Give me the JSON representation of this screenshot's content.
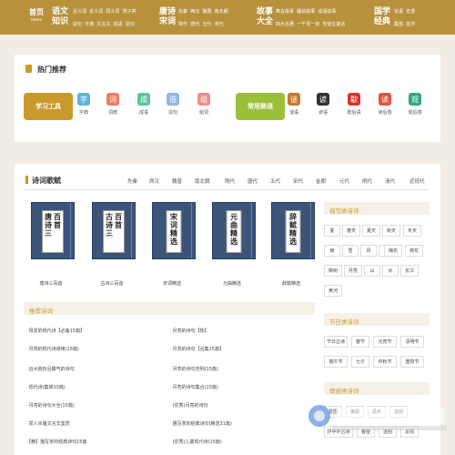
{
  "nav": {
    "home": "首页",
    "home_sub": "Home",
    "lang": "语文",
    "lang2": "知识",
    "lang_links": [
      "近义词",
      "反义词",
      "同义词",
      "类子类",
      "造句",
      "字典",
      "文言文",
      "成语",
      "造句"
    ],
    "poetry": "唐诗",
    "poetry2": "宋词",
    "poetry_links": [
      "先秦",
      "两汉",
      "魏晋",
      "南北朝",
      "隋代",
      "唐代",
      "五代",
      "宋代"
    ],
    "story": "故事",
    "story2": "大全",
    "story_links": [
      "寓言故事",
      "睡前故事",
      "成语故事",
      "四大名著",
      "一千零一夜",
      "安徒生童话"
    ],
    "classic": "国学",
    "classic2": "经典",
    "classic_links": [
      "论语",
      "史部",
      "集部",
      "善学"
    ]
  },
  "hot": {
    "title": "热门推荐",
    "study_label": "学习工具",
    "study_tools": [
      "字典",
      "词典",
      "成语",
      "造句",
      "组词"
    ],
    "common_label": "常用熟语",
    "common_tools": [
      "谜语",
      "谚语",
      "歇后语",
      "读后感",
      "观后感"
    ]
  },
  "poems": {
    "title": "诗词歌赋",
    "tabs": [
      "先秦",
      "两汉",
      "魏晋",
      "南北朝",
      "隋代",
      "唐代",
      "五代",
      "宋代",
      "金朝",
      "元代",
      "明代",
      "清代",
      "近现代"
    ],
    "books": [
      {
        "label": "唐诗三百首",
        "caption": "唐诗三百首"
      },
      {
        "label": "古诗三百首",
        "caption": "古诗三百首"
      },
      {
        "label": "宋词精选",
        "caption": "宋词精选"
      },
      {
        "label": "元曲精选",
        "caption": "元曲精选"
      },
      {
        "label": "辞赋精选",
        "caption": "辞赋精选"
      }
    ]
  },
  "recommend": {
    "title": "推荐诗词",
    "left": [
      "母爱的现代诗【必备15篇】",
      "月亮的现代诗通用(15篇)",
      "远大抱负且霸气的诗句",
      "现代诗(集锦15篇)",
      "月亮的诗句大全(15篇)",
      "郑人买履文言文鉴赏",
      "【精】描写茶的经典诗句15篇"
    ],
    "right": [
      "月亮的诗句【热】",
      "月亮的诗句【合集15篇】",
      "月亮的诗句范例(15篇)",
      "月亮的诗句集合(15篇)",
      "(优秀)月亮的诗句",
      "描写茶的经典诗句(精选31篇)",
      "(优秀)儿童现代诗(15篇)"
    ]
  },
  "scenery": {
    "title": "描写类诗词",
    "cells": [
      [
        "夏",
        "春天",
        "夏天",
        "秋天",
        "冬天"
      ],
      [
        "雨",
        "雪",
        "风",
        "花",
        "梅花",
        "荷花"
      ],
      [
        "柳树",
        "月亮",
        "山",
        "水",
        "长江"
      ],
      [
        "黄河"
      ]
    ]
  },
  "festival": {
    "title": "节日类诗词",
    "cells": [
      [
        "节日古诗",
        "春节",
        "元宵节",
        "清明节"
      ],
      [
        "端午节",
        "七夕",
        "中秋节",
        "重阳节"
      ]
    ]
  },
  "emotion": {
    "title": "情感类诗词",
    "cells": [
      [
        "爱国",
        "离别",
        "思乡",
        "送别"
      ],
      [
        "抒中怀古诗",
        "春望",
        "送别",
        "友情"
      ]
    ]
  },
  "colors": {
    "nav": "#b8913d",
    "study": "#c89a2c",
    "common": "#9bbf3a",
    "book": "#3c5479",
    "bg": "#f1ede4"
  }
}
